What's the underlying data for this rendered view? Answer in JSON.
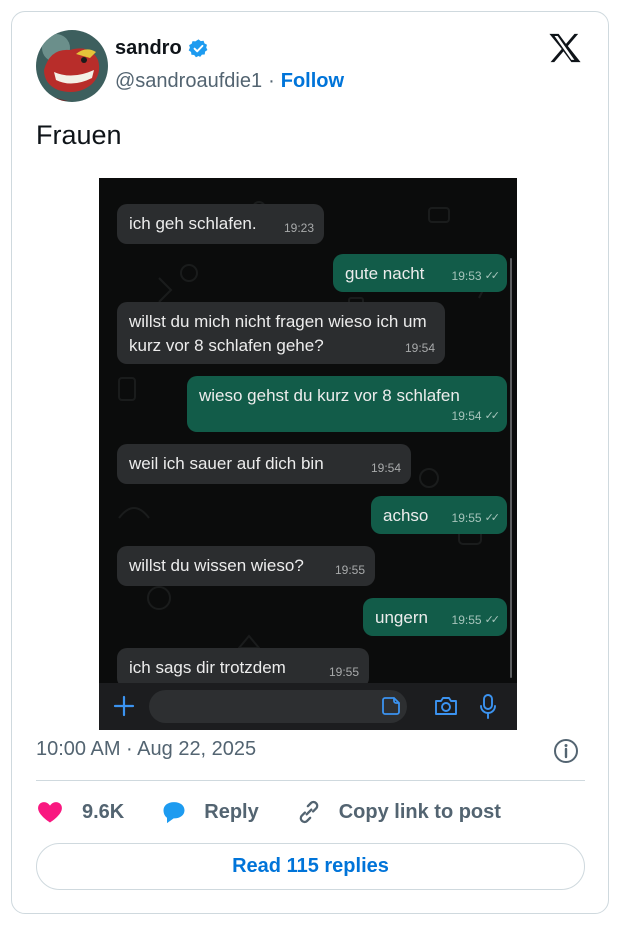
{
  "author": {
    "name": "sandro",
    "handle": "@sandroaufdie1",
    "separator": "·",
    "follow_label": "Follow",
    "verified": true
  },
  "brand_icon": "x-logo-icon",
  "tweet": {
    "text": "Frauen",
    "timestamp": "10:00 AM · Aug 22, 2025"
  },
  "chat": {
    "messages": [
      {
        "direction": "in",
        "text": "ich geh schlafen.",
        "time": "19:23"
      },
      {
        "direction": "out",
        "text": "gute nacht",
        "time": "19:53"
      },
      {
        "direction": "in",
        "text": "willst du mich nicht fragen wieso ich um kurz vor 8 schlafen gehe?",
        "time": "19:54"
      },
      {
        "direction": "out",
        "text": "wieso gehst du kurz vor 8 schlafen",
        "time": "19:54"
      },
      {
        "direction": "in",
        "text": "weil ich sauer auf dich bin",
        "time": "19:54"
      },
      {
        "direction": "out",
        "text": "achso",
        "time": "19:55"
      },
      {
        "direction": "in",
        "text": "willst du wissen wieso?",
        "time": "19:55"
      },
      {
        "direction": "out",
        "text": "ungern",
        "time": "19:55"
      },
      {
        "direction": "in",
        "text": "ich sags dir trotzdem",
        "time": "19:55"
      }
    ],
    "input_icons": [
      "plus-icon",
      "sticker-icon",
      "camera-icon",
      "mic-icon"
    ]
  },
  "actions": {
    "like_count": "9.6K",
    "reply_label": "Reply",
    "copy_label": "Copy link to post",
    "read_replies_label": "Read 115 replies"
  },
  "colors": {
    "link": "#0074d9",
    "like": "#f91880",
    "reply_icon": "#1d9bf0",
    "outgoing_bubble": "#125c49",
    "incoming_bubble": "#2b2d2f"
  }
}
